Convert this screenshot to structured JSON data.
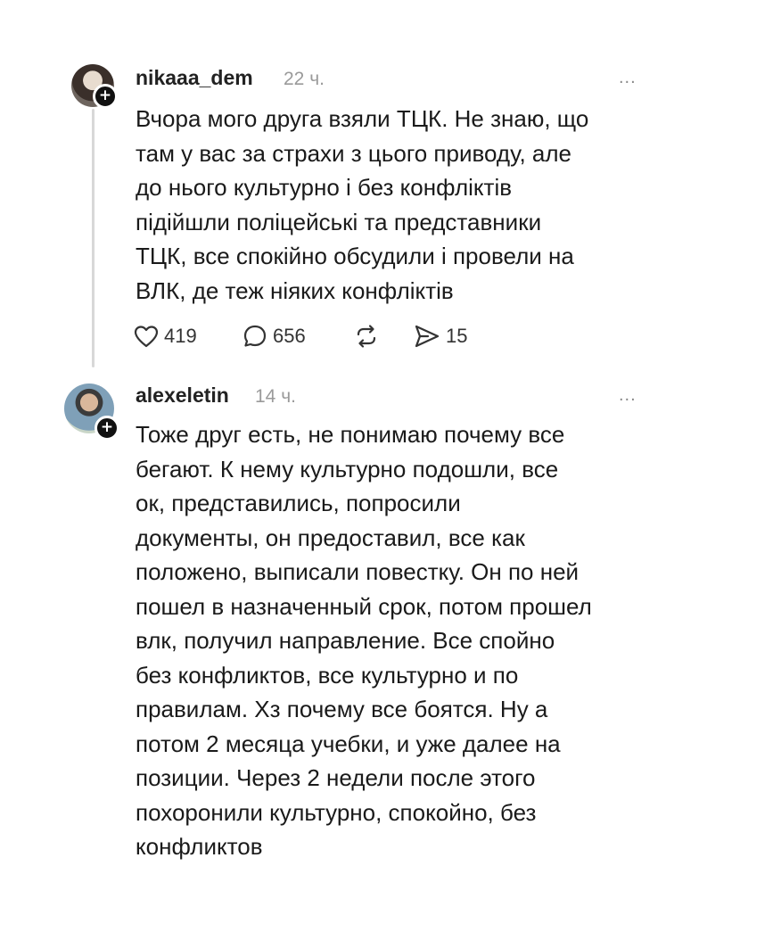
{
  "comments": [
    {
      "username": "nikaaa_dem",
      "time": "22 ч.",
      "more": "...",
      "text": "Вчора мого друга взяли ТЦК. Не знаю, що\nтам у вас за страхи з цього приводу, але\nдо нього культурно і без конфліктів\nпідійшли поліцейські та представники\nТЦК, все спокійно обсудили і провели на\nВЛК, де теж ніяких конфліктів",
      "likes": "419",
      "replies": "656",
      "shares": "15"
    },
    {
      "username": "alexeletin",
      "time": "14 ч.",
      "more": "...",
      "text": "Тоже друг есть, не понимаю почему все\nбегают. К нему культурно подошли, все\nок, представились, попросили\nдокументы, он предоставил, все как\nположено, выписали повестку. Он по ней\nпошел в назначенный срок, потом прошел\nвлк, получил направление. Все спойно\nбез конфликтов, все культурно и по\nправилам. Хз почему все боятся. Ну а\nпотом 2 месяца учебки, и уже далее на\nпозиции. Через 2 недели после этого\nпохоронили культурно, спокойно, без\nконфликтов"
    }
  ],
  "icons": {
    "like": "heart-icon",
    "reply": "comment-icon",
    "repost": "repost-icon",
    "share": "send-icon",
    "follow": "plus-icon"
  }
}
